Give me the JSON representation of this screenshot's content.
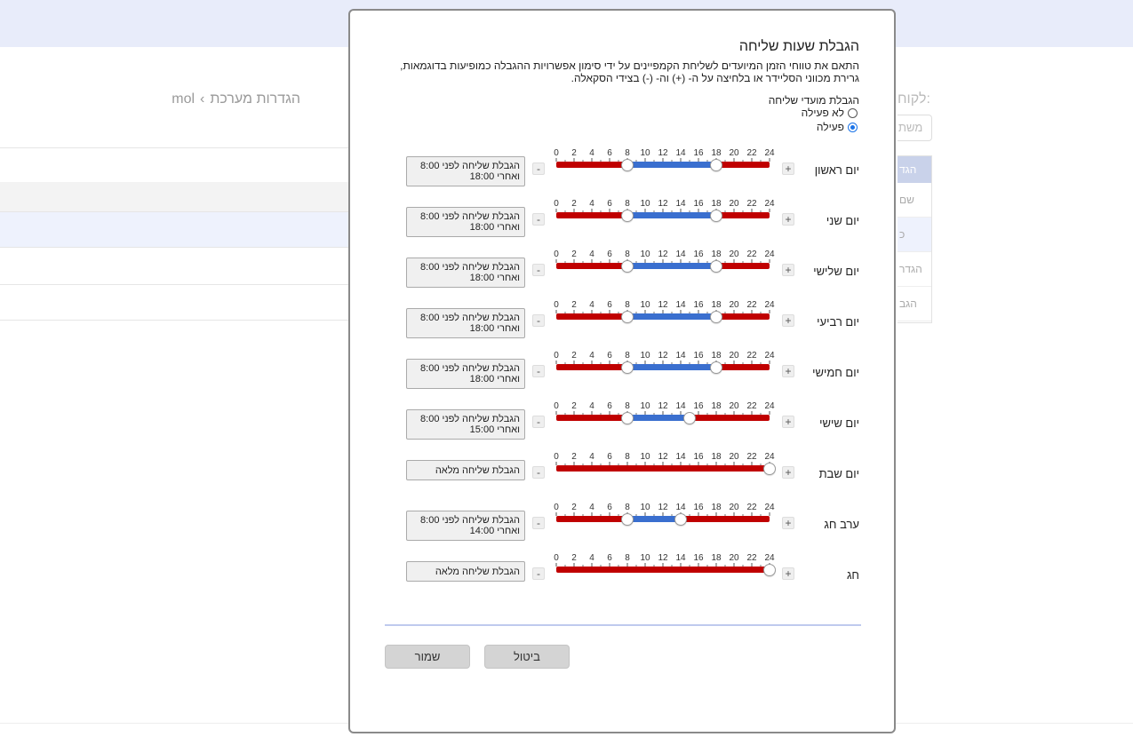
{
  "background": {
    "breadcrumb": [
      "הגדרות מערכת",
      "mol"
    ],
    "right_title": "לקוח:",
    "right_input": "משת",
    "panel": {
      "header": "הגד",
      "items": [
        "שם",
        "כ",
        "הגדר",
        "הגב"
      ]
    }
  },
  "dialog": {
    "title": "הגבלת שעות שליחה",
    "description": "התאם את טווחי הזמן המיועדים לשליחת הקמפיינים על ידי סימון אפשרויות ההגבלה כמופיעות בדוגמאות, גרירת מכווני הסליידר או בלחיצה על ה- (+) וה- (-) בצידי הסקאלה.",
    "mode_label": "הגבלת מועדי שליחה",
    "options": [
      {
        "label": "לא פעילה",
        "checked": false
      },
      {
        "label": "פעילה",
        "checked": true
      }
    ],
    "scale_ticks": [
      "0",
      "2",
      "4",
      "6",
      "8",
      "10",
      "12",
      "14",
      "16",
      "18",
      "20",
      "22",
      "24"
    ],
    "plus": "+",
    "minus": "-",
    "days": [
      {
        "name": "יום ראשון",
        "status_line1": "הגבלת שליחה לפני 8:00",
        "status_line2": "ואחרי 18:00",
        "start": 8,
        "end": 18,
        "full": false
      },
      {
        "name": "יום שני",
        "status_line1": "הגבלת שליחה לפני 8:00",
        "status_line2": "ואחרי 18:00",
        "start": 8,
        "end": 18,
        "full": false
      },
      {
        "name": "יום שלישי",
        "status_line1": "הגבלת שליחה לפני 8:00",
        "status_line2": "ואחרי 18:00",
        "start": 8,
        "end": 18,
        "full": false
      },
      {
        "name": "יום רביעי",
        "status_line1": "הגבלת שליחה לפני 8:00",
        "status_line2": "ואחרי 18:00",
        "start": 8,
        "end": 18,
        "full": false
      },
      {
        "name": "יום חמישי",
        "status_line1": "הגבלת שליחה לפני 8:00",
        "status_line2": "ואחרי 18:00",
        "start": 8,
        "end": 18,
        "full": false
      },
      {
        "name": "יום שישי",
        "status_line1": "הגבלת שליחה לפני 8:00",
        "status_line2": "ואחרי 15:00",
        "start": 8,
        "end": 15,
        "full": false
      },
      {
        "name": "יום שבת",
        "status_line1": "הגבלת שליחה מלאה",
        "status_line2": "",
        "start": 24,
        "end": 24,
        "full": true
      },
      {
        "name": "ערב חג",
        "status_line1": "הגבלת שליחה לפני 8:00",
        "status_line2": "ואחרי 14:00",
        "start": 8,
        "end": 14,
        "full": false
      },
      {
        "name": "חג",
        "status_line1": "הגבלת שליחה מלאה",
        "status_line2": "",
        "start": 24,
        "end": 24,
        "full": true
      }
    ],
    "buttons": {
      "cancel": "ביטול",
      "save": "שמור"
    },
    "colors": {
      "restricted": "#c00000",
      "allowed": "#3a6fcf",
      "accent": "#1a73e8"
    }
  }
}
